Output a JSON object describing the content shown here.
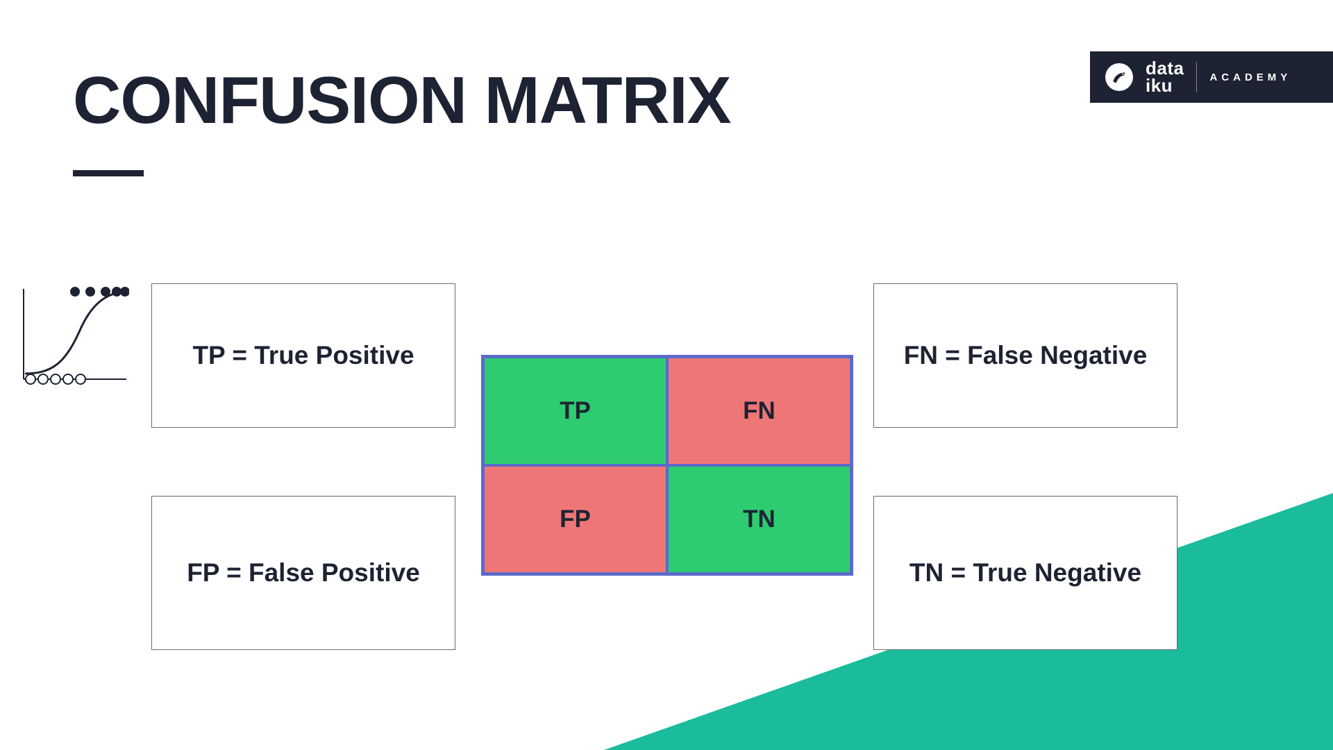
{
  "title": "CONFUSION MATRIX",
  "brand": {
    "line1": "data",
    "line2": "iku",
    "sub": "ACADEMY"
  },
  "defs": {
    "tp": "TP = True Positive",
    "fn": "FN = False Negative",
    "fp": "FP = False Positive",
    "tn": "TN = True Negative"
  },
  "matrix": {
    "tp": "TP",
    "fn": "FN",
    "fp": "FP",
    "tn": "TN"
  },
  "colors": {
    "dark": "#1d2333",
    "teal": "#1abc9c",
    "green": "#2ecc71",
    "red": "#ef7676",
    "blue": "#5b6acb"
  }
}
